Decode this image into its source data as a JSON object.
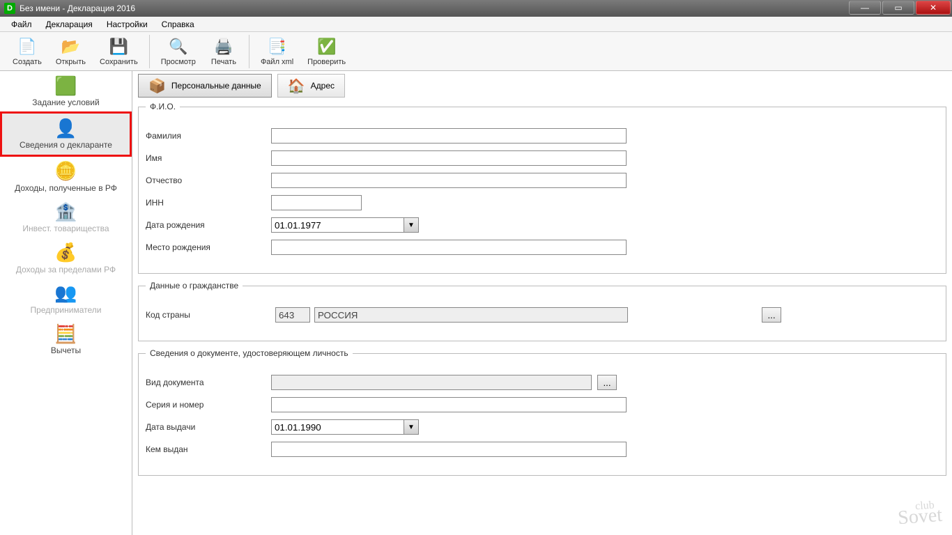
{
  "window": {
    "title": "Без имени - Декларация 2016"
  },
  "menu": {
    "file": "Файл",
    "decl": "Декларация",
    "settings": "Настройки",
    "help": "Справка"
  },
  "toolbar": {
    "create": "Создать",
    "open": "Открыть",
    "save": "Сохранить",
    "preview": "Просмотр",
    "print": "Печать",
    "xml": "Файл xml",
    "check": "Проверить"
  },
  "sidebar": {
    "conditions": "Задание условий",
    "declarant": "Сведения о декларанте",
    "income_rf": "Доходы, полученные в РФ",
    "invest": "Инвест. товарищества",
    "income_abroad": "Доходы за пределами РФ",
    "entrepreneurs": "Предприниматели",
    "deductions": "Вычеты"
  },
  "tabs": {
    "personal": "Персональные данные",
    "address": "Адрес"
  },
  "fio": {
    "legend": "Ф.И.О.",
    "surname": "Фамилия",
    "surname_val": "",
    "name": "Имя",
    "name_val": "",
    "patronymic": "Отчество",
    "patronymic_val": "",
    "inn": "ИНН",
    "inn_val": "",
    "birth": "Дата рождения",
    "birth_val": "01.01.1977",
    "birthplace": "Место рождения",
    "birthplace_val": ""
  },
  "citizenship": {
    "legend": "Данные о гражданстве",
    "country_code_label": "Код страны",
    "code": "643",
    "name": "РОССИЯ"
  },
  "document": {
    "legend": "Сведения о документе, удостоверяющем личность",
    "type_label": "Вид документа",
    "type_val": "",
    "series_label": "Серия и номер",
    "series_val": "",
    "issue_date_label": "Дата выдачи",
    "issue_date_val": "01.01.1990",
    "issuer_label": "Кем выдан",
    "issuer_val": ""
  },
  "ellipsis": "...",
  "watermark": {
    "top": "club",
    "main": "Sovet"
  }
}
